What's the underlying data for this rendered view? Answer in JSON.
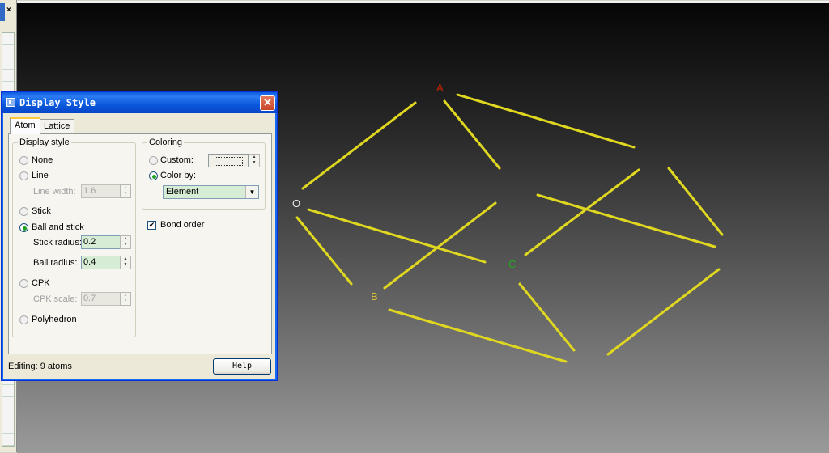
{
  "dialog": {
    "title": "Display Style",
    "tabs": [
      {
        "label": "Atom",
        "active": true
      },
      {
        "label": "Lattice",
        "active": false
      }
    ],
    "display_style": {
      "group_label": "Display style",
      "options": {
        "none": "None",
        "line": "Line",
        "line_width_label": "Line width:",
        "line_width_value": "1.6",
        "stick": "Stick",
        "ball_and_stick": "Ball and stick",
        "stick_radius_label": "Stick radius:",
        "stick_radius_value": "0.2",
        "ball_radius_label": "Ball radius:",
        "ball_radius_value": "0.4",
        "cpk": "CPK",
        "cpk_scale_label": "CPK scale:",
        "cpk_scale_value": "0.7",
        "polyhedron": "Polyhedron"
      },
      "selected": "Ball and stick"
    },
    "coloring": {
      "group_label": "Coloring",
      "custom_label": "Custom:",
      "color_by_label": "Color by:",
      "selected": "Color by:",
      "color_by_value": "Element"
    },
    "bond_order": {
      "label": "Bond order",
      "checked": true,
      "mark": "✔"
    },
    "status": "Editing: 9 atoms",
    "help_label": "Help",
    "close_glyph": "✕"
  },
  "viewport": {
    "atom_labels": [
      {
        "text": "A",
        "color": "#cc2200"
      },
      {
        "text": "O",
        "color": "#e8e8e8"
      },
      {
        "text": "C",
        "color": "#22aa22"
      },
      {
        "text": "B",
        "color": "#d8c030"
      }
    ],
    "bond_color": "#e0d820"
  },
  "side_panel": {
    "close_glyph": "×"
  },
  "icons": {
    "close": "close-icon",
    "window": "window-icon",
    "chevron_down": "chevron-down-icon",
    "spin_up": "chevron-up-icon",
    "spin_down": "chevron-down-icon"
  },
  "glyphs": {
    "dropdown": "▼",
    "spin_up": "▲",
    "spin_down": "▼"
  }
}
